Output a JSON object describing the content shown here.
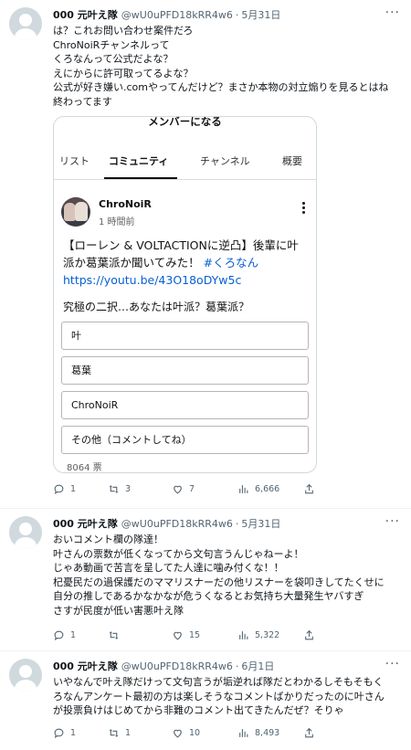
{
  "tweets": [
    {
      "name": "000 元叶え隊",
      "handle": "@wU0uPFD18kRR4w6",
      "date": "5月31日",
      "text": "は？これお問い合わせ案件だろ\nChroNoiRチャンネルって\nくろなんって公式だよな？\nえにからに許可取ってるよな？\n公式が好き嫌い.comやってんだけど？まさか本物の対立煽りを見るとはね\n終わってます",
      "reply_count": "1",
      "retweet_count": "3",
      "like_count": "7",
      "view_count": "6,666"
    },
    {
      "name": "000 元叶え隊",
      "handle": "@wU0uPFD18kRR4w6",
      "date": "5月31日",
      "text": "おいコメント欄の隊達！\n叶さんの票数が低くなってから文句言うんじゃねーよ！\nじゃあ動画で苦言を呈してた人達に噛み付くな！！\n杞憂民だの過保護だのママリスナーだの他リスナーを袋叩きしてたくせに\n自分の推しであるかなかなが危うくなるとお気持ち大量発生ヤバすぎ\nさすが民度が低い害悪叶え隊",
      "reply_count": "1",
      "retweet_count": "",
      "like_count": "15",
      "view_count": "5,322"
    },
    {
      "name": "000 元叶え隊",
      "handle": "@wU0uPFD18kRR4w6",
      "date": "6月1日",
      "text": "いやなんで叶え隊だけって文句言うが垢逆れば隊だとわかるしそもそもく\nろなんアンケート最初の方は楽しそうなコメントばかりだったのに叶さん\nが投票負けはじめてから非難のコメント出てきたんだぜ？そりゃ",
      "reply_count": "1",
      "retweet_count": "1",
      "like_count": "10",
      "view_count": "8,493"
    }
  ],
  "embed": {
    "member_button": "メンバーになる",
    "tabs": [
      "リスト",
      "コミュニティ",
      "チャンネル",
      "概要"
    ],
    "channel_name": "ChroNoiR",
    "post_time": "1 時間前",
    "post_text": "【ローレン & VOLTACTIONに逆凸】後輩に叶派か葛葉派か聞いてみた！",
    "hashtag": "#くろなん",
    "link": "https://youtu.be/43O18oDYw5c",
    "question": "究極の二択…あなたは叶派？葛葉派？",
    "options": [
      "叶",
      "葛葉",
      "ChroNoiR",
      "その他（コメントしてね）"
    ],
    "votes": "8064 票"
  },
  "colors": {
    "text": "#0f1419",
    "secondary": "#536471",
    "link": "#065fd4",
    "divider": "#eff3f4"
  },
  "icons": [
    "more-icon",
    "reply-icon",
    "retweet-icon",
    "like-icon",
    "views-icon",
    "share-icon"
  ]
}
